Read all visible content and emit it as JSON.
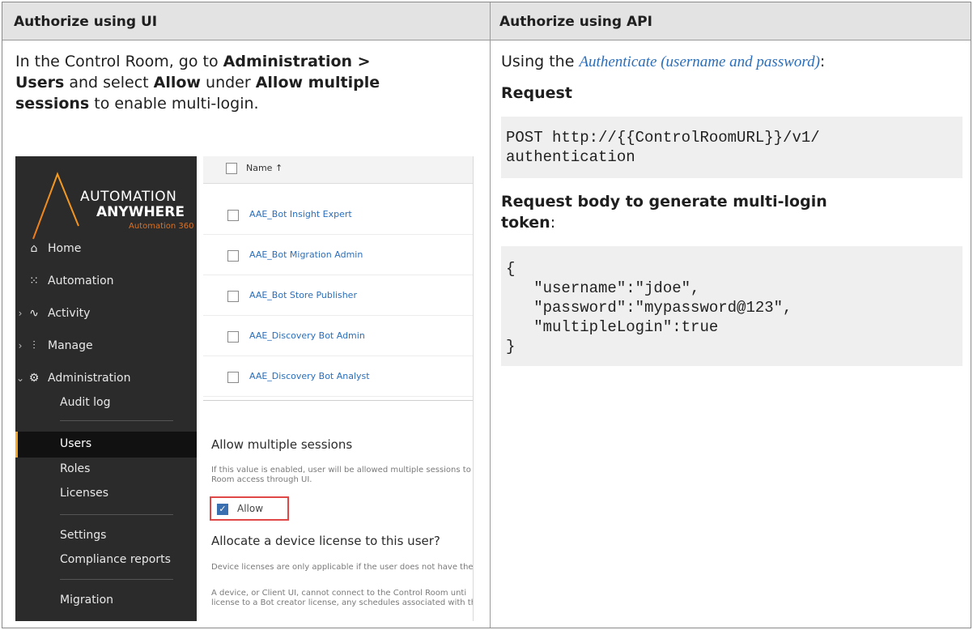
{
  "header": {
    "left_title": "Authorize using UI",
    "right_title": "Authorize using API"
  },
  "left": {
    "t1": "In the Control Room, go to ",
    "b1": "Administration >",
    "b2": "Users",
    "t2": " and select ",
    "b3": "Allow",
    "t3": " under ",
    "b4": "Allow multiple",
    "b5": "sessions",
    "t4": " to enable multi-login."
  },
  "shot": {
    "logo_line1": "AUTOMATION",
    "logo_line2": "ANYWHERE",
    "logo_line3": "Automation 360",
    "nav": [
      {
        "label": "Home"
      },
      {
        "label": "Automation"
      },
      {
        "label": "Activity"
      },
      {
        "label": "Manage"
      },
      {
        "label": "Administration"
      }
    ],
    "sub": [
      "Audit log",
      "Users",
      "Roles",
      "Licenses",
      "Settings",
      "Compliance reports",
      "Migration"
    ],
    "list_header": "Name ↑",
    "rows": [
      "AAE_Bot Insight Expert",
      "AAE_Bot Migration Admin",
      "AAE_Bot Store Publisher",
      "AAE_Discovery Bot Admin",
      "AAE_Discovery Bot Analyst"
    ],
    "ms_title": "Allow multiple sessions",
    "ms_desc": "If this value is enabled, user will be allowed multiple sessions to t Room access through UI.",
    "allow_label": "Allow",
    "dl_title": "Allocate a device license to this user?",
    "dl_1": "Device licenses are only applicable if the user does not have the",
    "dl_2a": "A device, or Client UI, cannot connect to the Control Room unti",
    "dl_2b": "license to a Bot creator license, any schedules associated with th"
  },
  "right": {
    "intro_pre": "Using the ",
    "intro_link": "Authenticate (username and password)",
    "intro_post": ":",
    "request_heading": "Request",
    "request_line1": "POST http://{{ControlRoomURL}}/v1/",
    "request_line2": "authentication",
    "body_heading_a": "Request body to generate multi-login",
    "body_heading_b": "token",
    "body_heading_c": ":",
    "body_lines": [
      "{",
      "   \"username\":\"jdoe\",",
      "   \"password\":\"mypassword@123\",",
      "   \"multipleLogin\":true",
      "}"
    ]
  }
}
